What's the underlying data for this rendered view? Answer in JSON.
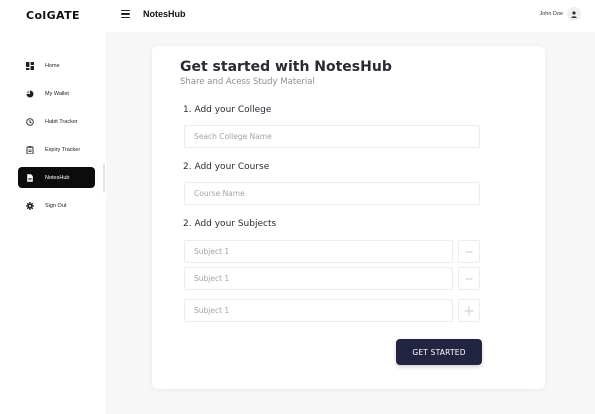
{
  "header": {
    "logo": "ColGATE",
    "app_title": "NotesHub",
    "user_name": "John Doe"
  },
  "sidebar": {
    "items": [
      {
        "label": "Home",
        "icon": "dashboard-icon",
        "active": false
      },
      {
        "label": "My Wallet",
        "icon": "wallet-icon",
        "active": false
      },
      {
        "label": "Habit Tracker",
        "icon": "clock-icon",
        "active": false
      },
      {
        "label": "Expiry Tracker",
        "icon": "clipboard-icon",
        "active": false
      },
      {
        "label": "NotesHub",
        "icon": "note-icon",
        "active": true
      },
      {
        "label": "Sign Out",
        "icon": "gear-icon",
        "active": false
      }
    ]
  },
  "form": {
    "title": "Get started with NotesHub",
    "subtitle": "Share and Acess Study Material",
    "college_label": "1. Add your College",
    "college_placeholder": "Seach College Name",
    "course_label": "2. Add your Course",
    "course_placeholder": "Course Name",
    "subjects_label": "2. Add your Subjects",
    "subjects": [
      {
        "placeholder": "Subject 1",
        "action": "remove"
      },
      {
        "placeholder": "Subject 1",
        "action": "remove"
      },
      {
        "placeholder": "Subject 1",
        "action": "add"
      }
    ],
    "submit_label": "GET STARTED"
  },
  "colors": {
    "accent": "#222441",
    "active_nav": "#0c0c0c",
    "page_bg": "#f7f7f8"
  }
}
